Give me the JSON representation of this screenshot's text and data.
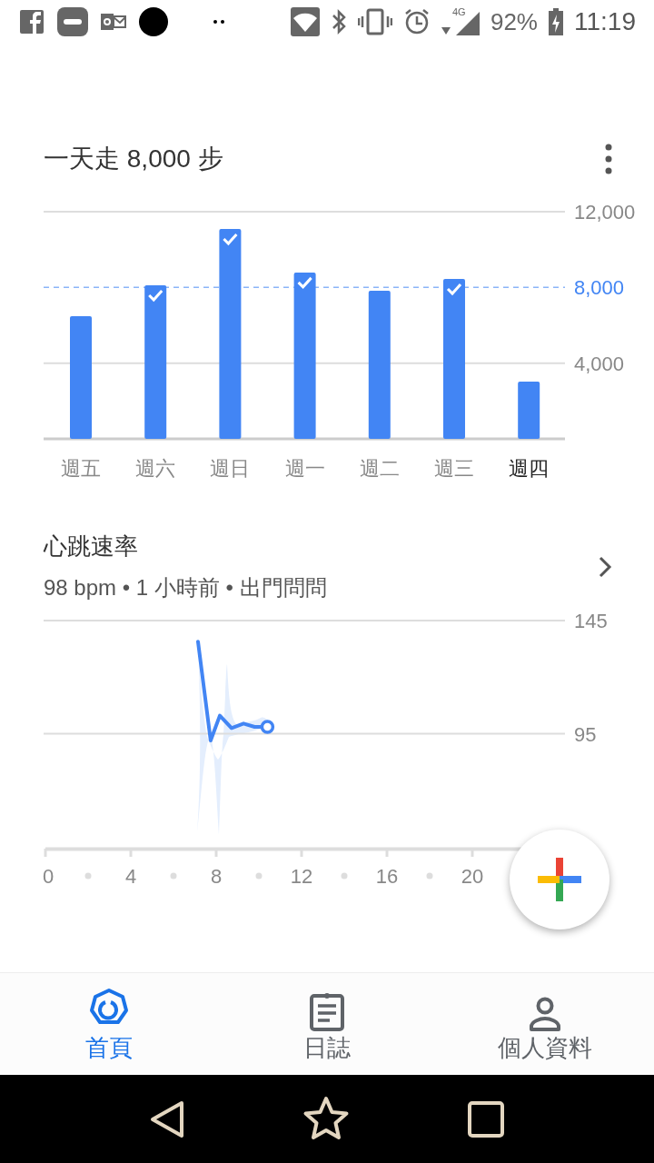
{
  "status_bar": {
    "battery": "92%",
    "time": "11:19",
    "network": "4G"
  },
  "steps_card": {
    "title": "一天走 8,000 步",
    "chart_data": {
      "type": "bar",
      "categories": [
        "週五",
        "週六",
        "週日",
        "週一",
        "週二",
        "週三",
        "週四"
      ],
      "series": [
        {
          "color": "#4285f4",
          "values": [
            6480,
            8110,
            11090,
            8790,
            7830,
            8450,
            3020
          ]
        }
      ],
      "ylim": [
        0,
        12000
      ],
      "yticks": [
        {
          "value": 4000,
          "label": "4,000"
        },
        {
          "value": 12000,
          "label": "12,000"
        }
      ],
      "ref_lines": [
        {
          "axis": "y",
          "value": 8000,
          "label": "8,000",
          "color": "#8ab4f8"
        }
      ]
    },
    "days": [
      {
        "selected": false
      },
      {
        "selected": false
      },
      {
        "selected": false
      },
      {
        "selected": false
      },
      {
        "selected": false
      },
      {
        "selected": false
      },
      {
        "selected": true
      }
    ]
  },
  "heart_card": {
    "title": "心跳速率",
    "subtitle": "98 bpm • 1 小時前 • 出門問問",
    "chart_data": {
      "type": "line",
      "x": [
        7.15,
        7.74,
        8.17,
        8.72,
        9.28,
        9.8,
        10.4
      ],
      "series": [
        {
          "color": "#4285f4",
          "values": [
            135.7,
            92,
            103,
            97.5,
            99.5,
            98,
            98
          ]
        }
      ],
      "xlim": [
        0,
        24
      ],
      "ylim": [
        44,
        145
      ],
      "xticks": [
        0,
        4,
        8,
        12,
        16,
        20
      ],
      "yticks": [
        95,
        145
      ]
    }
  },
  "bottom_nav": [
    {
      "label": "首頁",
      "kind": "home",
      "selected": true
    },
    {
      "label": "日誌",
      "kind": "journal",
      "selected": false
    },
    {
      "label": "個人資料",
      "kind": "profile",
      "selected": false
    }
  ]
}
